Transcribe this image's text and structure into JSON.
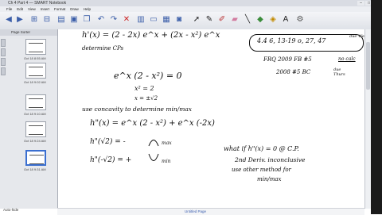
{
  "window": {
    "title": "Ch 4 Part 4 — SMART Notebook"
  },
  "menu": [
    "File",
    "Edit",
    "View",
    "Insert",
    "Format",
    "Draw",
    "Help"
  ],
  "toolbar": {
    "tool_icons": [
      "back-icon",
      "forward-icon",
      "add-page-icon",
      "delete-page-icon",
      "open-icon",
      "save-icon",
      "paste-icon",
      "undo-icon",
      "redo-icon",
      "delete-icon",
      "screen-shade-icon",
      "display-icon",
      "table-icon",
      "document-camera-icon",
      "select-icon",
      "pen-icon",
      "creative-pen-icon",
      "eraser-icon",
      "line-icon",
      "shape-icon",
      "fill-icon",
      "text-icon",
      "properties-icon"
    ]
  },
  "sidebar": {
    "header": "Page Sorter",
    "thumbnails": [
      {
        "label": "Oct 18 8:55 AM"
      },
      {
        "label": "Oct 18 9:02 AM"
      },
      {
        "label": "Oct 18 9:10 AM"
      },
      {
        "label": "Oct 18 9:24 AM"
      },
      {
        "label": "Oct 18 9:31 AM"
      }
    ],
    "autohide": "Auto-hide"
  },
  "canvas": {
    "line1": "h'(x) = (2 - 2x) e^x + (2x - x²) e^x",
    "line2": "determine CPs",
    "line3": "e^x (2 - x²) = 0",
    "line4": "x² = 2",
    "line5": "x = ±√2",
    "line6": "use concavity to determine min/max",
    "line7": "h\"(x) = e^x (2 - x²) + e^x (-2x)",
    "line8": "h\"(√2) = -",
    "line8b": "max",
    "line9": "h\"(-√2) = +",
    "line9b": "min",
    "hw_box": "4.4   6, 13-19 o, 27, 47",
    "hw_due": "due Wed",
    "frq1": "FRQ 2009 FB #5",
    "frq1_note": "no calc",
    "frq2": "2008 #5 BC",
    "frq2_due": "due Thurs",
    "note1": "what if h\"(x) = 0 @ C.P.",
    "note2": "2nd Deriv. inconclusive",
    "note3": "use other method for",
    "note4": "min/max"
  },
  "status": {
    "text": "Untitled Page"
  }
}
